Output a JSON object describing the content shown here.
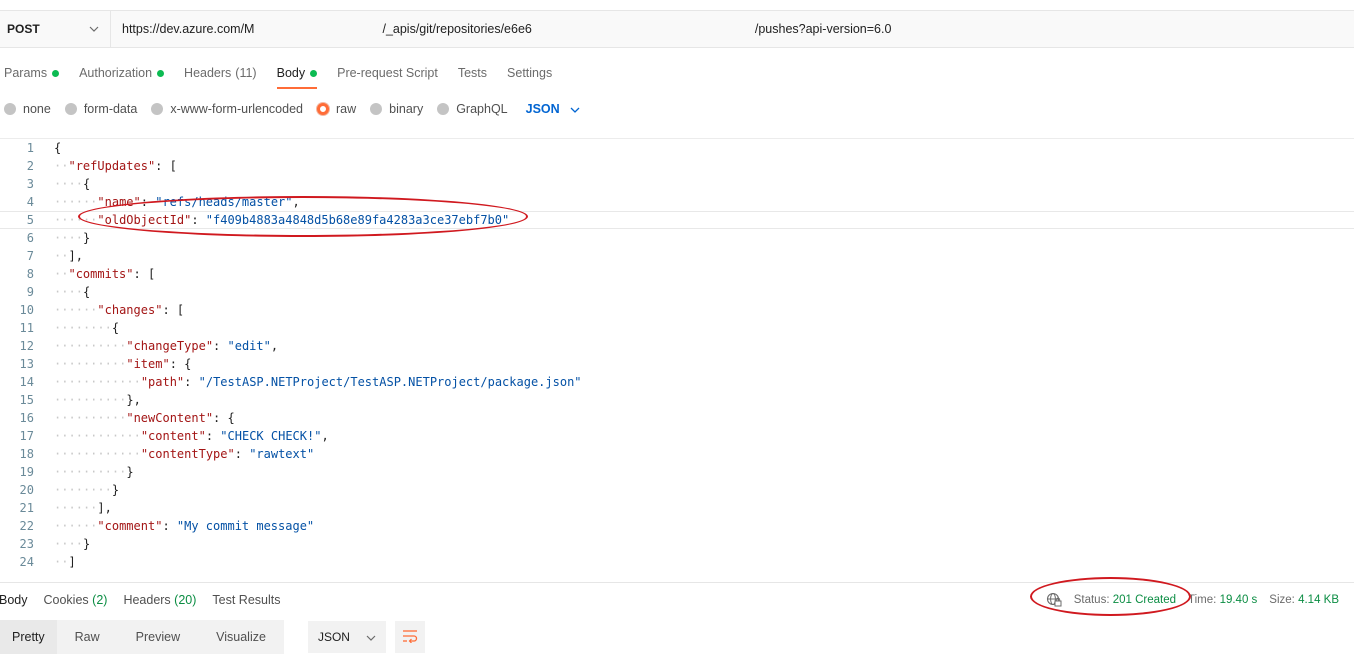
{
  "request": {
    "method": "POST",
    "url_start": "https://dev.azure.com/M",
    "url_middle": "/_apis/git/repositories/e6e6",
    "url_end": "/pushes?api-version=6.0"
  },
  "request_tabs": [
    {
      "label": "Params",
      "count": "",
      "dot": true
    },
    {
      "label": "Authorization",
      "count": "",
      "dot": true
    },
    {
      "label": "Headers",
      "count": "(11)",
      "dot": false
    },
    {
      "label": "Body",
      "count": "",
      "dot": true
    },
    {
      "label": "Pre-request Script",
      "count": "",
      "dot": false
    },
    {
      "label": "Tests",
      "count": "",
      "dot": false
    },
    {
      "label": "Settings",
      "count": "",
      "dot": false
    }
  ],
  "body_types": [
    "none",
    "form-data",
    "x-www-form-urlencoded",
    "raw",
    "binary",
    "GraphQL"
  ],
  "body_type_selected": "raw",
  "language": "JSON",
  "editor_lines": [
    "{",
    "  \"refUpdates\": [",
    "    {",
    "      \"name\": \"refs/heads/master\",",
    "      \"oldObjectId\": \"f409b4883a4848d5b68e89fa4283a3ce37ebf7b0\"",
    "    }",
    "  ],",
    "  \"commits\": [",
    "    {",
    "      \"changes\": [",
    "        {",
    "          \"changeType\": \"edit\",",
    "          \"item\": {",
    "            \"path\": \"/TestASP.NETProject/TestASP.NETProject/package.json\"",
    "          },",
    "          \"newContent\": {",
    "            \"content\": \"CHECK CHECK!\",",
    "            \"contentType\": \"rawtext\"",
    "          }",
    "        }",
    "      ],",
    "      \"comment\": \"My commit message\"",
    "    }",
    "  ]"
  ],
  "response": {
    "tabs": [
      {
        "label": "Body",
        "count": ""
      },
      {
        "label": "Cookies",
        "count": "(2)"
      },
      {
        "label": "Headers",
        "count": "(20)"
      },
      {
        "label": "Test Results",
        "count": ""
      }
    ],
    "status_label": "Status:",
    "status_value": "201 Created",
    "time_label": "Time:",
    "time_value": "19.40 s",
    "size_label": "Size:",
    "size_value": "4.14 KB"
  },
  "view_tabs": [
    "Pretty",
    "Raw",
    "Preview",
    "Visualize"
  ],
  "view_selected": "Pretty",
  "response_format": "JSON",
  "colors": {
    "accent": "#ff6c37",
    "status_green": "#0b8d43",
    "annotation_red": "#d0191f",
    "json_key": "#a31515",
    "json_string": "#0451a5"
  }
}
